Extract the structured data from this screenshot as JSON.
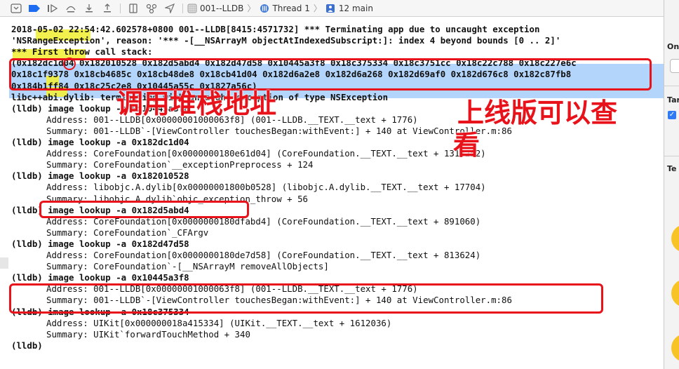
{
  "toolbar": {
    "icons": [
      "hide-console-icon",
      "breakpoint-toggle-icon",
      "continue-icon",
      "step-over-icon",
      "step-into-icon",
      "step-out-icon",
      "view-hierarchy-icon",
      "memory-graph-icon",
      "location-icon"
    ],
    "crumbs": [
      {
        "label": "001--LLDB",
        "icon": "app-target-icon"
      },
      {
        "label": "Thread 1",
        "icon": "thread-icon"
      },
      {
        "label": "12 main",
        "icon": "stack-frame-icon"
      }
    ]
  },
  "console": {
    "lines": [
      {
        "text": "2018-05-02 22:54:42.602578+0800 001--LLDB[8415:4571732] *** Terminating app due to uncaught exception",
        "indent": false
      },
      {
        "text": "'NSRangeException', reason: '*** -[__NSArrayM objectAtIndexedSubscript:]: index 4 beyond bounds [0 .. 2]'",
        "indent": false
      },
      {
        "text": "*** First throw call stack:",
        "indent": false
      },
      {
        "text": "(0x182dc1d04 0x182010528 0x182d5abd4 0x182d47d58 0x10445a3f8 0x18c375334 0x18c3751cc 0x18c22c788 0x18c227e6c",
        "indent": false
      },
      {
        "text": "0x18c1f9378 0x18cb4685c 0x18cb48de8 0x18cb41d04 0x182d6a2e8 0x182d6a268 0x182d69af0 0x182d676c8 0x182c87fb8",
        "indent": false
      },
      {
        "text": "0x184b1ff84 0x18c25c2e8 0x10445a55c 0x1827a56c)",
        "indent": false
      },
      {
        "text": "libc++abi.dylib: terminating with uncaught exception of type NSException",
        "indent": false
      },
      {
        "text": "(lldb) image lookup -a 0x10445a3f8",
        "indent": false
      },
      {
        "text": "Address: 001--LLDB[0x00000001000063f8] (001--LLDB.__TEXT.__text + 1776)",
        "indent": true
      },
      {
        "text": "Summary: 001--LLDB`-[ViewController touchesBegan:withEvent:] + 140 at ViewController.m:86",
        "indent": true
      },
      {
        "text": "(lldb) image lookup -a 0x182dc1d04",
        "indent": false
      },
      {
        "text": "Address: CoreFoundation[0x0000000180e61d04] (CoreFoundation.__TEXT.__text + 1313252)",
        "indent": true
      },
      {
        "text": "Summary: CoreFoundation`__exceptionPreprocess + 124",
        "indent": true
      },
      {
        "text": "(lldb) image lookup -a 0x182010528",
        "indent": false
      },
      {
        "text": "Address: libobjc.A.dylib[0x00000001800b0528] (libobjc.A.dylib.__TEXT.__text + 17704)",
        "indent": true
      },
      {
        "text": "Summary: libobjc.A.dylib`objc_exception_throw + 56",
        "indent": true
      },
      {
        "text": "(lldb) image lookup -a 0x182d5abd4",
        "indent": false
      },
      {
        "text": "Address: CoreFoundation[0x0000000180dfabd4] (CoreFoundation.__TEXT.__text + 891060)",
        "indent": true
      },
      {
        "text": "Summary: CoreFoundation`_CFArgv",
        "indent": true
      },
      {
        "text": "(lldb) image lookup -a 0x182d47d58",
        "indent": false
      },
      {
        "text": "Address: CoreFoundation[0x0000000180de7d58] (CoreFoundation.__TEXT.__text + 813624)",
        "indent": true
      },
      {
        "text": "Summary: CoreFoundation`-[__NSArrayM removeAllObjects]",
        "indent": true
      },
      {
        "text": "(lldb) image lookup -a 0x10445a3f8",
        "indent": false
      },
      {
        "text": "Address: 001--LLDB[0x00000001000063f8] (001--LLDB.__TEXT.__text + 1776)",
        "indent": true
      },
      {
        "text": "Summary: 001--LLDB`-[ViewController touchesBegan:withEvent:] + 140 at ViewController.m:86",
        "indent": true
      },
      {
        "text": "(lldb) image lookup -a 0x18c375334",
        "indent": false
      },
      {
        "text": "Address: UIKit[0x000000018a415334] (UIKit.__TEXT.__text + 1612036)",
        "indent": true
      },
      {
        "text": "Summary: UIKit`forwardTouchMethod + 340",
        "indent": true
      },
      {
        "text": "(lldb)",
        "indent": false
      }
    ]
  },
  "annotations": {
    "call_stack_address": "调用堆栈地址",
    "online_viewable": [
      "上线版可以查",
      "看"
    ]
  },
  "inspector": {
    "labels": [
      "On",
      "Tar",
      "Te"
    ]
  },
  "colors": {
    "annotation": "#e8121b",
    "selection": "#b3d5fb",
    "highlight": "#f1ef3a"
  }
}
